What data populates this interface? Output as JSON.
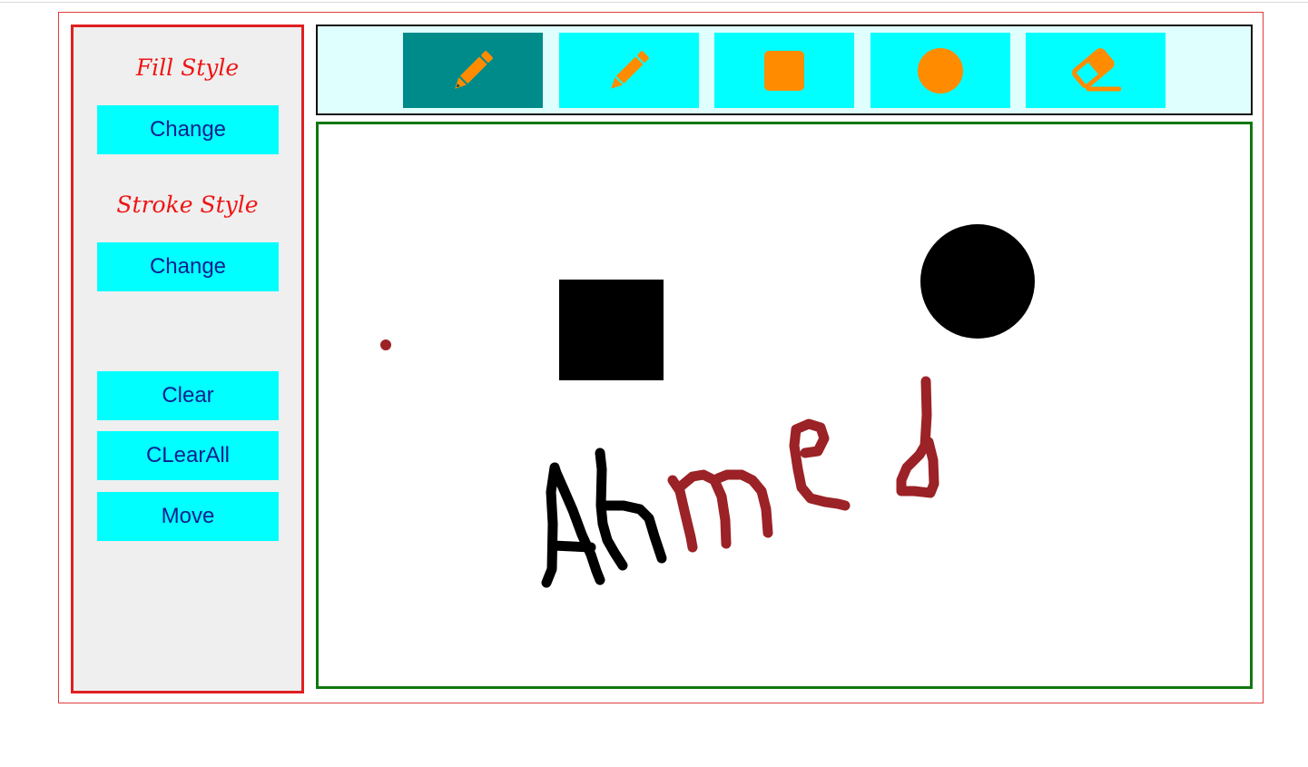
{
  "sidebar": {
    "fill_title": "Fill Style",
    "fill_change": "Change",
    "stroke_title": "Stroke Style",
    "stroke_change": "Change",
    "clear": "Clear",
    "clear_all": "CLearAll",
    "move": "Move"
  },
  "toolbar": {
    "tools": [
      {
        "icon": "pencil-icon",
        "active": true
      },
      {
        "icon": "pencil-icon",
        "active": false
      },
      {
        "icon": "square-icon",
        "active": false
      },
      {
        "icon": "circle-icon",
        "active": false
      },
      {
        "icon": "eraser-icon",
        "active": false
      }
    ]
  },
  "colors": {
    "accent": "#00ffff",
    "active_tool": "#008b8b",
    "icon": "#ff8c00",
    "title_text": "#f01414",
    "button_text": "#0d1f8f",
    "ink_dark": "#000000",
    "ink_red": "#9b2226",
    "canvas_border": "#117711"
  },
  "canvas": {
    "drawings": [
      "dot",
      "filled-square",
      "filled-circle",
      "handwritten-word"
    ]
  }
}
